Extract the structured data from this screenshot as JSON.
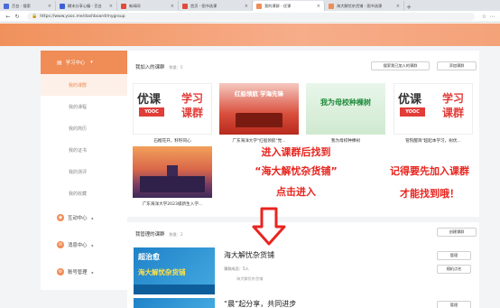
{
  "browser": {
    "tabs": [
      {
        "label": "百台 - 搜索",
        "color": "#4a6bd8"
      },
      {
        "label": "糊末分享心编 - 百台",
        "color": "#3d5fd6"
      },
      {
        "label": "新闻网",
        "color": "#e14b3b"
      },
      {
        "label": "首页 - 图书选课",
        "color": "#e14b3b"
      },
      {
        "label": "我的课群 - 优课",
        "color": "#f08c56",
        "active": true
      },
      {
        "label": "海大解忧杂货铺 - 图书选课",
        "color": "#f08c56"
      }
    ],
    "url": "https://www.yooc.me/dashboard/mygroup"
  },
  "sidebar": {
    "header": "学习中心",
    "items": [
      {
        "label": "我的课群",
        "active": true
      },
      {
        "label": "我的课程"
      },
      {
        "label": "我的简历"
      },
      {
        "label": "我的证书"
      },
      {
        "label": "我的测评"
      },
      {
        "label": "我的收藏"
      }
    ],
    "groups": [
      {
        "label": "互动中心"
      },
      {
        "label": "消息中心"
      },
      {
        "label": "账号管理"
      }
    ]
  },
  "joined": {
    "title": "我加入的课群",
    "count": "数量：5",
    "search_btn": "搜索我已加入的课群",
    "add_btn": "添加课群",
    "cards": [
      {
        "title": "石榴花开，籽籽同心",
        "cover": "yooc"
      },
      {
        "title": "广东海洋大学\"红船领航\"党...",
        "cover": "red",
        "cover_text": "红船领航 学海先锋"
      },
      {
        "title": "我为母校种棵树",
        "cover": "green",
        "cover_text": "我为母校种棵树"
      },
      {
        "title": "管院醒目\"超起本学习，树优...",
        "cover": "yooc"
      },
      {
        "title": "广东海洋大学2023级新生入学...",
        "cover": "sunset"
      }
    ]
  },
  "managed": {
    "title": "我管理的课群",
    "count": "数量：2",
    "create_btn": "创建课群",
    "group_name": "海大解忧杂货铺",
    "members": "课群成员：5人",
    "teacher": "海大解忧杂货铺",
    "btn_manage": "管理",
    "btn_roll": "随机点名",
    "cover_line1": "超治愈",
    "cover_line2": "海大解忧杂货铺",
    "next_name": "“晨”起分享，共同进步",
    "next_btn": "管理"
  },
  "yooc_logo": {
    "text": "优课",
    "badge": "YOOC",
    "right": "学习课群"
  },
  "annotations": {
    "line1": "进入课群后找到",
    "line2": "“海大解忧杂货铺”",
    "line3": "点击进入",
    "right1": "记得要先加入课群",
    "right2": "才能找到哦！"
  }
}
